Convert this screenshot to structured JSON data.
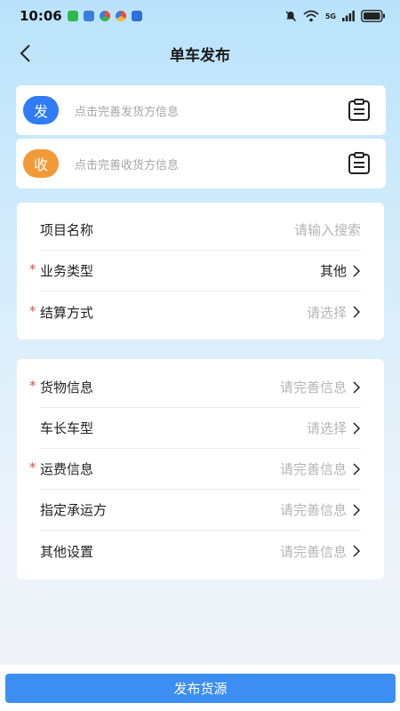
{
  "status_bar": {
    "time": "10:06",
    "network": "5G"
  },
  "nav": {
    "title": "单车发布"
  },
  "sender": {
    "badge": "发",
    "placeholder": "点击完善发货方信息",
    "badge_color": "#2f7cf6"
  },
  "receiver": {
    "badge": "收",
    "placeholder": "点击完善收货方信息",
    "badge_color": "#f29a38"
  },
  "section1": [
    {
      "label": "项目名称",
      "value": "请输入搜索",
      "required": false,
      "chevron": false,
      "filled": false
    },
    {
      "label": "业务类型",
      "value": "其他",
      "required": true,
      "chevron": true,
      "filled": true
    },
    {
      "label": "结算方式",
      "value": "请选择",
      "required": true,
      "chevron": true,
      "filled": false
    }
  ],
  "section2": [
    {
      "label": "货物信息",
      "value": "请完善信息",
      "required": true,
      "chevron": true,
      "filled": false
    },
    {
      "label": "车长车型",
      "value": "请选择",
      "required": false,
      "chevron": true,
      "filled": false
    },
    {
      "label": "运费信息",
      "value": "请完善信息",
      "required": true,
      "chevron": true,
      "filled": false
    },
    {
      "label": "指定承运方",
      "value": "请完善信息",
      "required": false,
      "chevron": true,
      "filled": false
    },
    {
      "label": "其他设置",
      "value": "请完善信息",
      "required": false,
      "chevron": true,
      "filled": false
    }
  ],
  "footer": {
    "publish_label": "发布货源"
  },
  "colors": {
    "accent": "#3c8ef3",
    "required": "#e0504a"
  }
}
